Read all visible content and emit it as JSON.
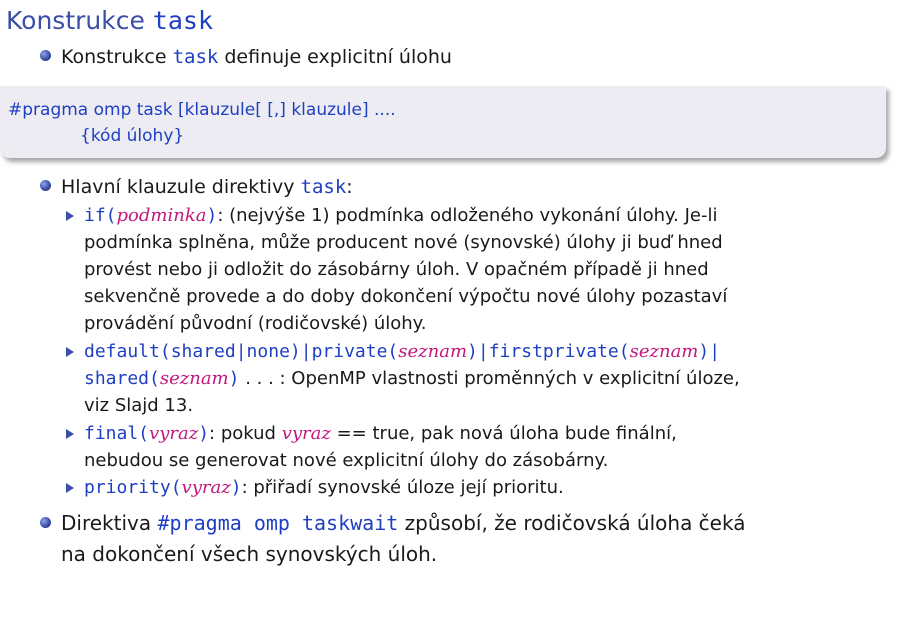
{
  "slide": {
    "title_text": "Konstrukce ",
    "title_code": "task"
  },
  "bullet1": {
    "pre": "Konstrukce ",
    "code": "task",
    "post": " definuje explicitní úlohu"
  },
  "code": {
    "line1": "#pragma omp task [klauzule[ [,] klauzule] ....",
    "line2": "{kód úlohy}"
  },
  "bullet2": {
    "pre": "Hlavní klauzule direktivy ",
    "code": "task",
    "post": ":"
  },
  "items": {
    "if": {
      "code1": "if(",
      "arg": "podminka",
      "code2": ")",
      "text_line1": ": (nejvýše 1) podmínka odloženého vykonání úlohy. Je-li",
      "text_line2": "podmínka splněna, může producent nové (synovské) úlohy ji buď hned",
      "text_line3": "provést nebo ji odložit do zásobárny úloh. V opačném případě ji hned",
      "text_line4": "sekvenčně provede a do doby dokončení výpočtu nové úlohy pozastaví",
      "text_line5": "provádění původní (rodičovské) úlohy."
    },
    "default": {
      "c1": "default(shared|none)|private(",
      "a1": "seznam",
      "c2": ")|firstprivate(",
      "a2": "seznam",
      "c3": ")|",
      "c4": "shared(",
      "a3": "seznam",
      "c5": ")",
      "text_line2": " . . . : OpenMP vlastnosti proměnných v explicitní úloze,",
      "text_line3": "viz Slajd 13."
    },
    "final": {
      "c1": "final(",
      "a1": "vyraz",
      "c2": ")",
      "t1": ": pokud ",
      "a2": "vyraz",
      "t2": " == true, pak nová úloha bude finální,",
      "text_line2": "nebudou se generovat nové explicitní úlohy do zásobárny."
    },
    "priority": {
      "c1": "priority(",
      "a1": "vyraz",
      "c2": ")",
      "t1": ": přiřadí synovské úloze její prioritu."
    }
  },
  "bullet3": {
    "pre": "Direktiva ",
    "code": "#pragma omp taskwait",
    "post": " způsobí, že rodičovská úloha čeká",
    "line2": "na dokončení všech synovských úloh."
  }
}
